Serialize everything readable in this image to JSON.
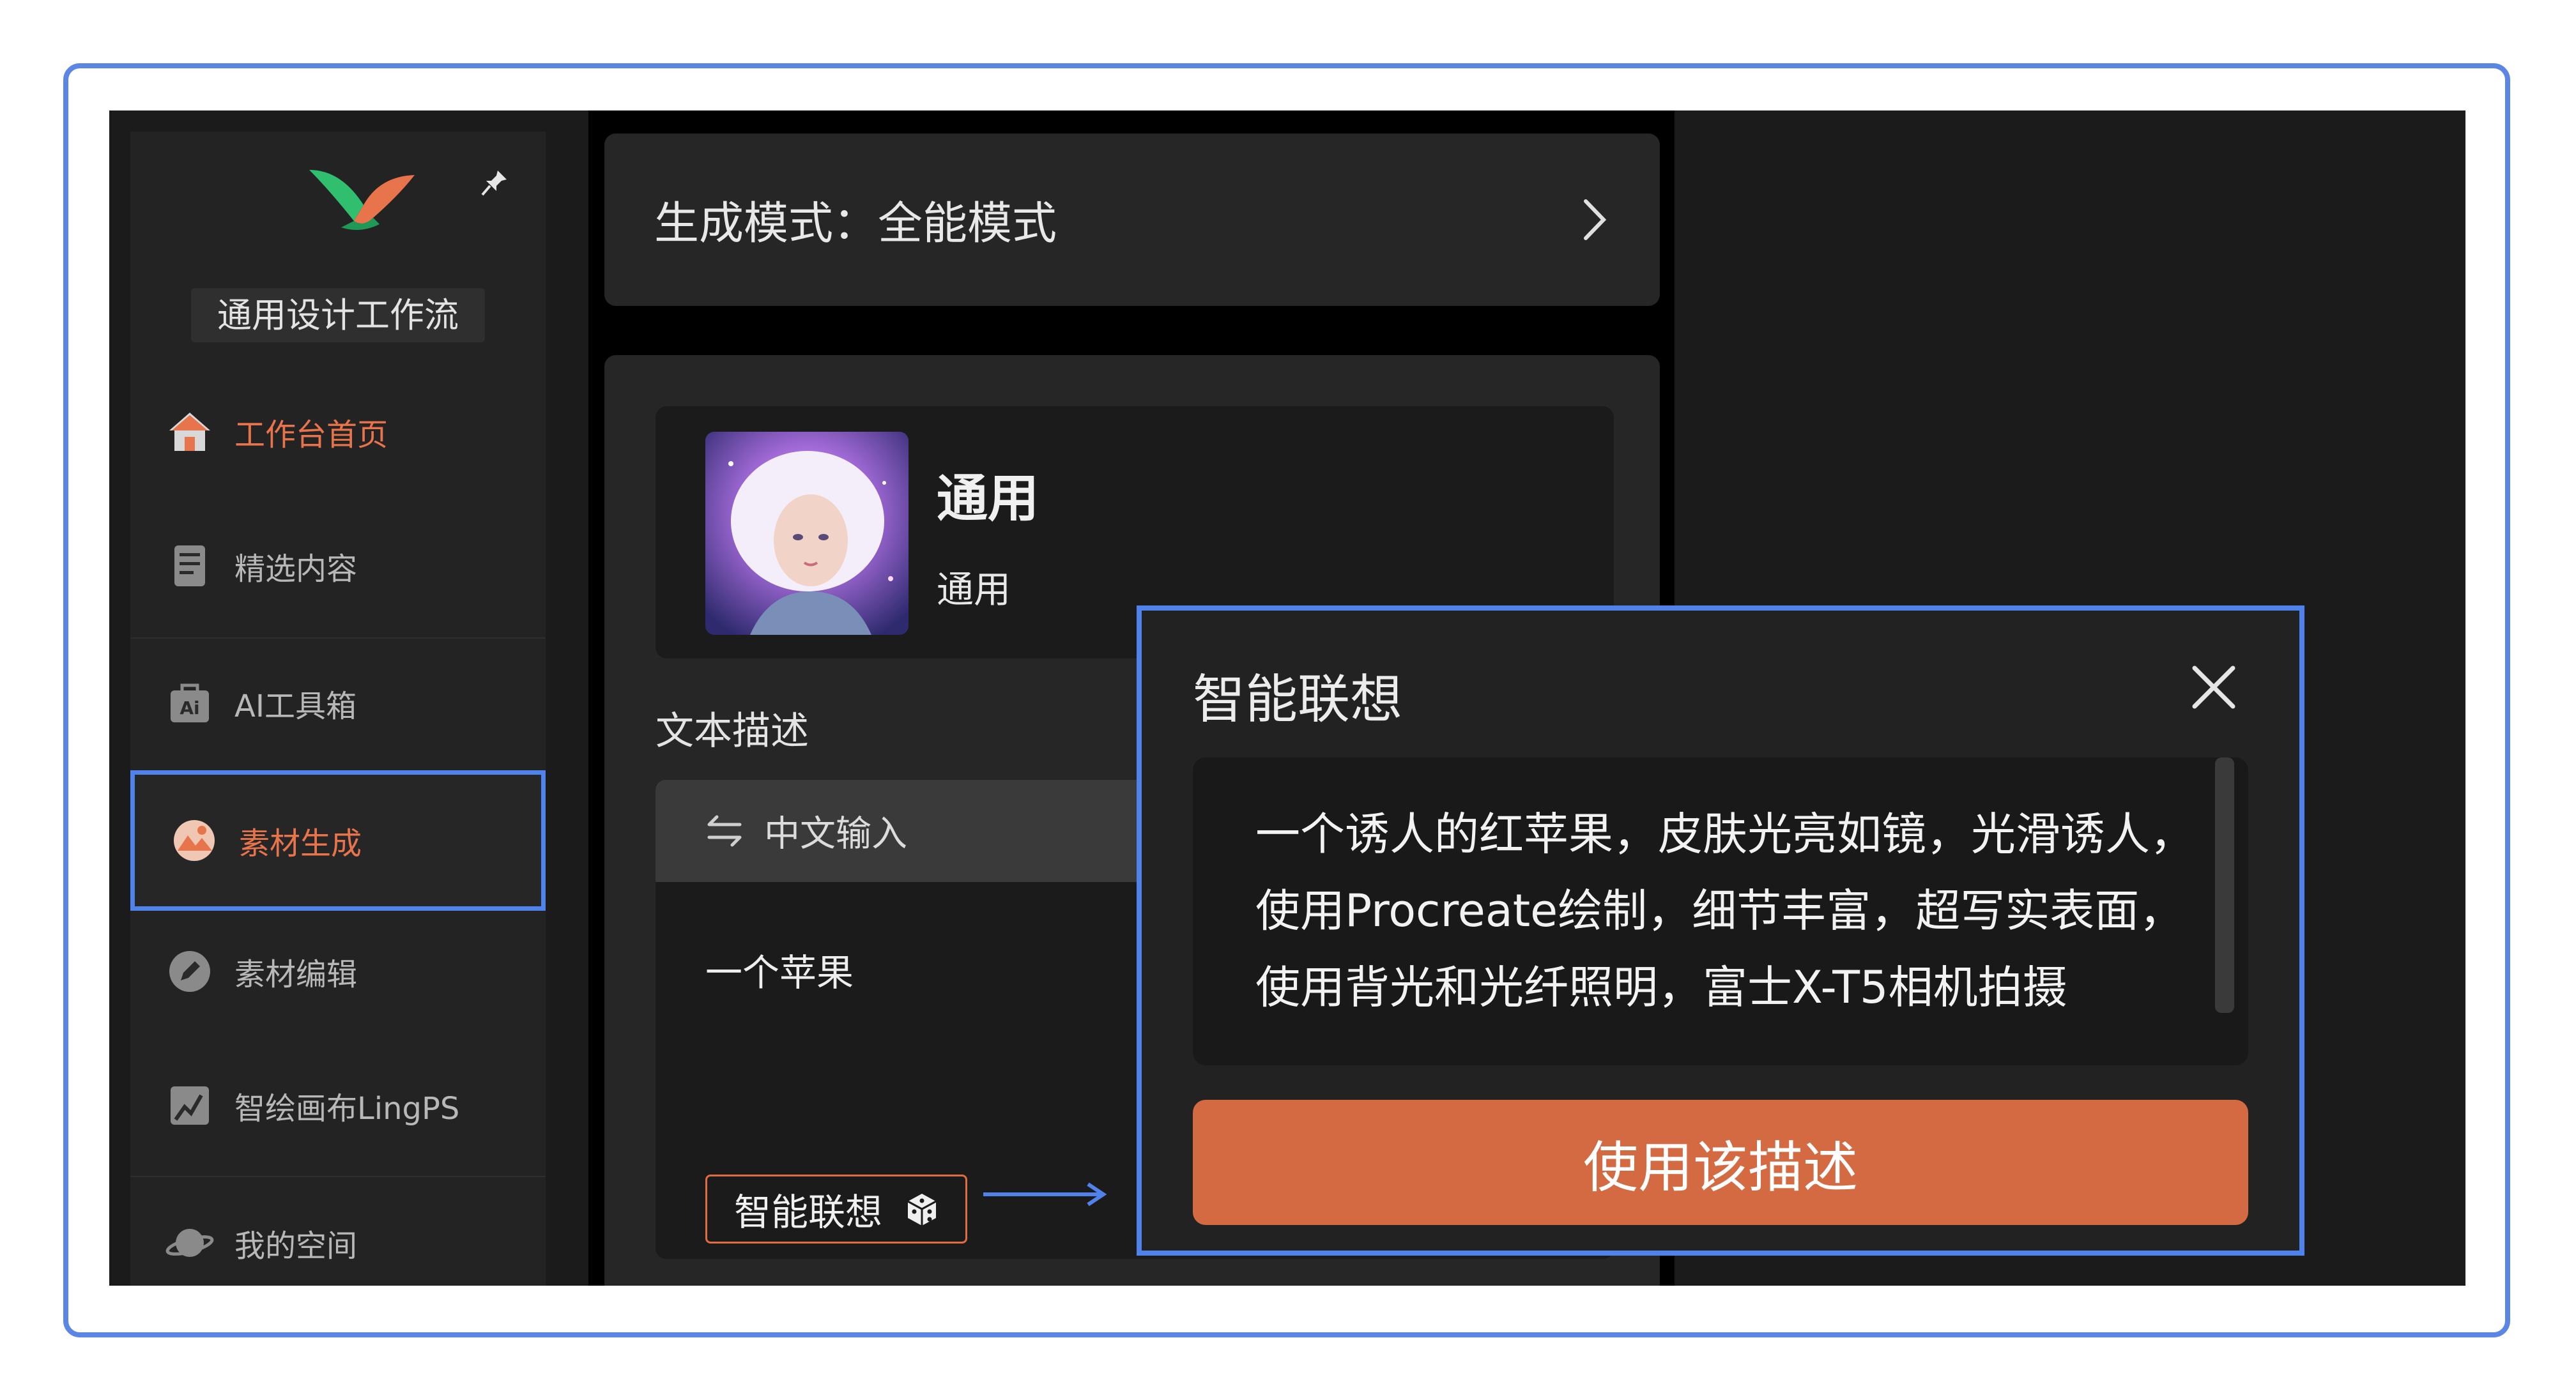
{
  "sidebar": {
    "workflow_label": "通用设计工作流",
    "items": [
      {
        "label": "工作台首页",
        "icon": "home-icon",
        "state": "active"
      },
      {
        "label": "精选内容",
        "icon": "document-icon"
      },
      {
        "label": "AI工具箱",
        "icon": "ai-toolbox-icon"
      },
      {
        "label": "素材生成",
        "icon": "material-generate-icon",
        "state": "selected"
      },
      {
        "label": "素材编辑",
        "icon": "edit-icon"
      },
      {
        "label": "智绘画布LingPS",
        "icon": "canvas-icon"
      },
      {
        "label": "我的空间",
        "icon": "planet-icon"
      }
    ]
  },
  "mode": {
    "label": "生成模式：全能模式"
  },
  "style": {
    "title": "通用",
    "subtitle": "通用"
  },
  "description": {
    "label": "文本描述",
    "input_tab": "中文输入",
    "input_text": "一个苹果",
    "smart_button": "智能联想"
  },
  "popup": {
    "title": "智能联想",
    "text": "一个诱人的红苹果，皮肤光亮如镜，光滑诱人，使用Procreate绘制，细节丰富，超写实表面，使用背光和光纤照明，富士X-T5相机拍摄",
    "use_button": "使用该描述"
  },
  "colors": {
    "accent": "#d46a42",
    "active_text": "#e8744b",
    "highlight_border": "#4f82ea"
  }
}
